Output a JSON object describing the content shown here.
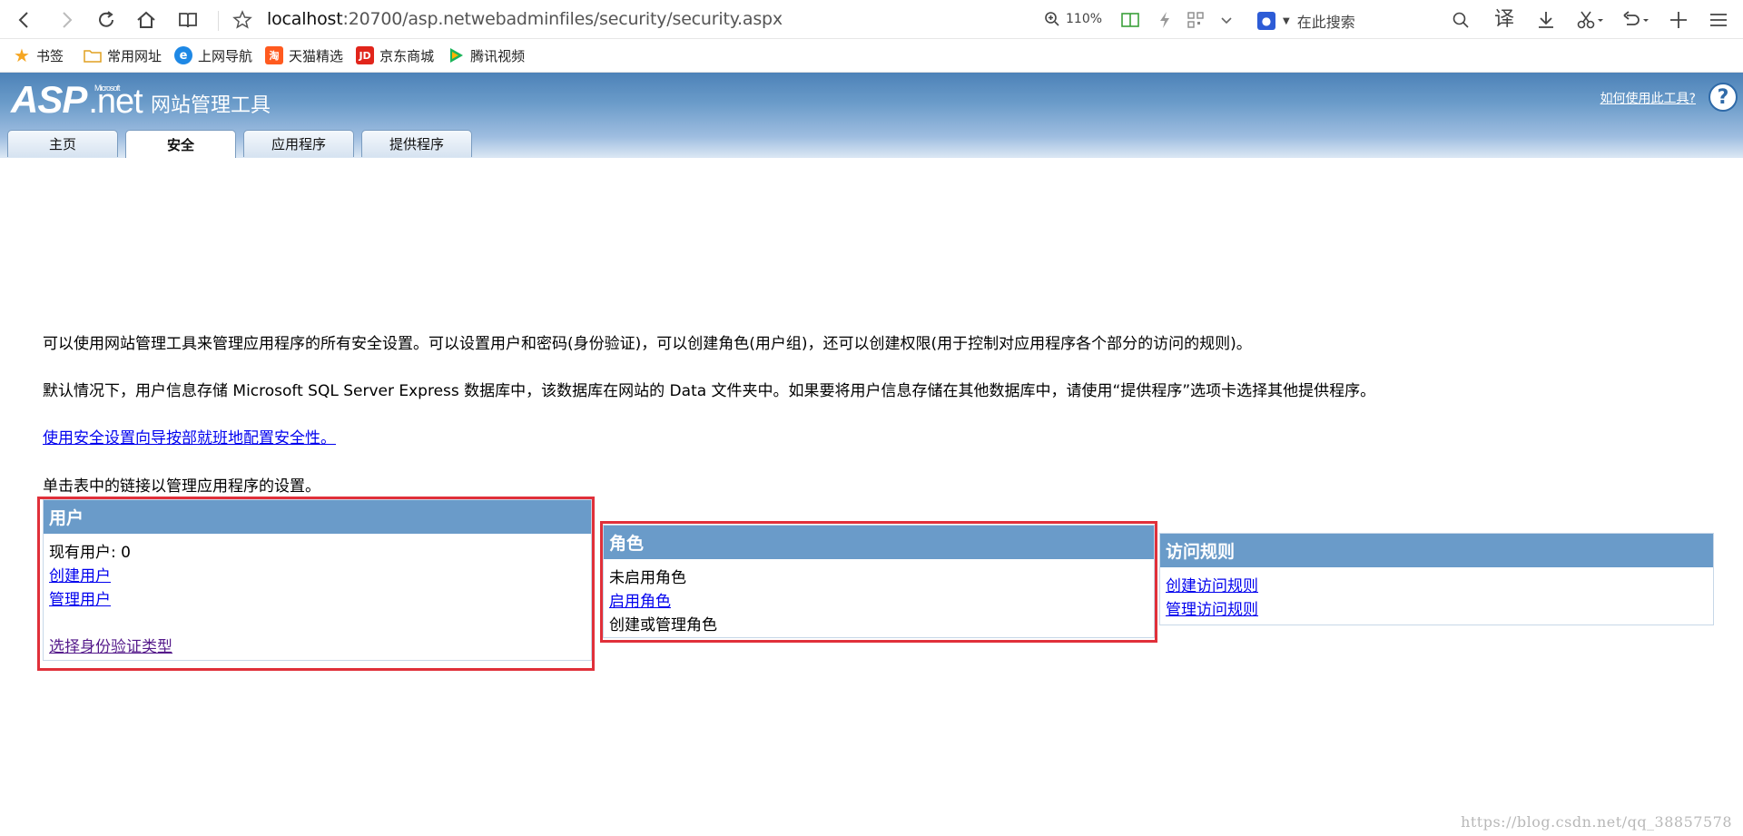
{
  "browser": {
    "url_host": "localhost",
    "url_rest": ":20700/asp.netwebadminfiles/security/security.aspx",
    "zoom": "110%",
    "search_placeholder": "在此搜索",
    "translate_label": "译"
  },
  "bookmarks": [
    {
      "label": "书签",
      "icon": "star-icon",
      "color": "#f5a623"
    },
    {
      "label": "常用网址",
      "icon": "folder-icon",
      "color": "#f0c050"
    },
    {
      "label": "上网导航",
      "icon": "ie-icon",
      "color": "#1e88e5"
    },
    {
      "label": "天猫精选",
      "icon": "tmall-icon",
      "color": "#ff5a1f"
    },
    {
      "label": "京东商城",
      "icon": "jd-icon",
      "color": "#e1251b"
    },
    {
      "label": "腾讯视频",
      "icon": "tencent-video-icon",
      "color": "#1bb45a"
    }
  ],
  "header": {
    "logo_asp": "ASP",
    "logo_net": ".net",
    "logo_ms": "Microsoft",
    "site_title": "网站管理工具",
    "help_link": "如何使用此工具?",
    "help_icon": "?"
  },
  "tabs": [
    {
      "label": "主页",
      "active": false
    },
    {
      "label": "安全",
      "active": true
    },
    {
      "label": "应用程序",
      "active": false
    },
    {
      "label": "提供程序",
      "active": false
    }
  ],
  "main": {
    "intro": "可以使用网站管理工具来管理应用程序的所有安全设置。可以设置用户和密码(身份验证)，可以创建角色(用户组)，还可以创建权限(用于控制对应用程序各个部分的访问的规则)。",
    "storage_note": "默认情况下，用户信息存储 Microsoft SQL Server Express 数据库中，该数据库在网站的 Data 文件夹中。如果要将用户信息存储在其他数据库中，请使用“提供程序”选项卡选择其他提供程序。",
    "wizard_link": "使用安全设置向导按部就班地配置安全性。",
    "click_note": "单击表中的链接以管理应用程序的设置。"
  },
  "panels": {
    "users": {
      "title": "用户",
      "count_label": "现有用户: 0",
      "create": "创建用户",
      "manage": "管理用户",
      "auth_type": "选择身份验证类型"
    },
    "roles": {
      "title": "角色",
      "status": "未启用角色",
      "enable": "启用角色",
      "manage": "创建或管理角色"
    },
    "access": {
      "title": "访问规则",
      "create": "创建访问规则",
      "manage": "管理访问规则"
    }
  },
  "watermark": "https://blog.csdn.net/qq_38857578",
  "colors": {
    "header_blue": "#6a9bc9",
    "highlight_red": "#e0303a",
    "link_blue": "#0000ee"
  }
}
